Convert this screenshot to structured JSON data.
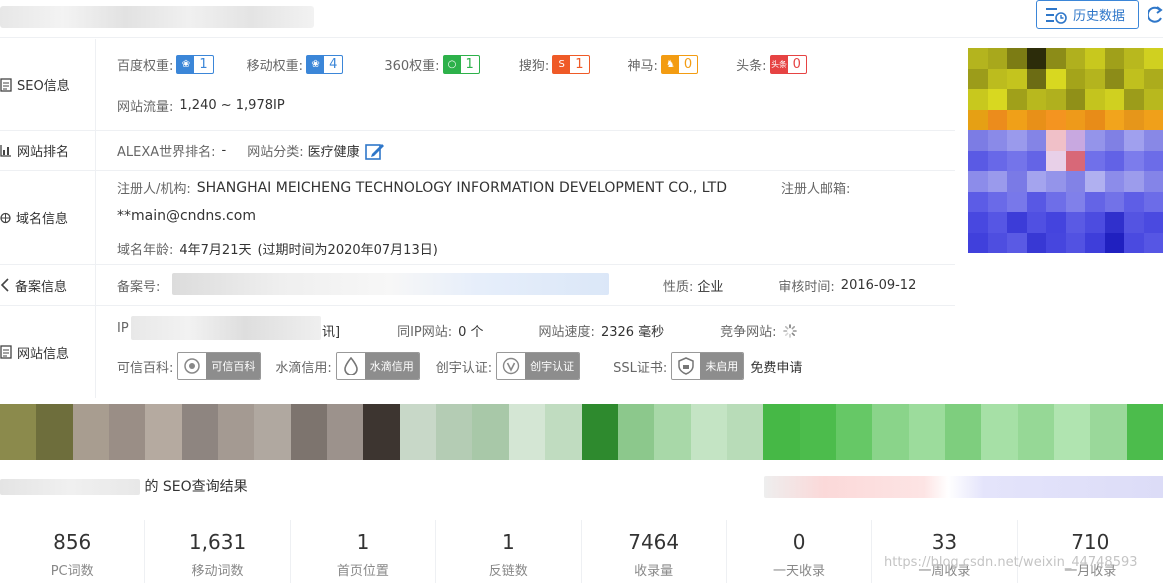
{
  "header": {
    "history_label": "历史数据"
  },
  "seo": {
    "label": "SEO信息",
    "baidu_key": "百度权重:",
    "baidu_val": "1",
    "mobile_key": "移动权重:",
    "mobile_val": "4",
    "q360_key": "360权重:",
    "q360_val": "1",
    "sogou_key": "搜狗:",
    "sogou_val": "1",
    "shenma_key": "神马:",
    "shenma_val": "0",
    "toutiao_key": "头条:",
    "toutiao_val": "0",
    "toutiao_icon_text": "头条",
    "traffic_key": "网站流量:",
    "traffic_val": "1,240 ~ 1,978IP"
  },
  "ranking": {
    "label": "网站排名",
    "alexa_key": "ALEXA世界排名:",
    "alexa_val": "-",
    "category_key": "网站分类:",
    "category_val": "医疗健康"
  },
  "domain": {
    "label": "域名信息",
    "registrant_key": "注册人/机构:",
    "registrant_val": "SHANGHAI MEICHENG TECHNOLOGY INFORMATION DEVELOPMENT CO., LTD",
    "email_key": "注册人邮箱:",
    "email_val": "**main@cndns.com",
    "age_key": "域名年龄:",
    "age_val": "4年7月21天",
    "expire_val": "(过期时间为2020年07月13日)"
  },
  "icp": {
    "label": "备案信息",
    "number_key": "备案号:",
    "nature_key": "性质:",
    "nature_val": "企业",
    "audit_key": "审核时间:",
    "audit_val": "2016-09-12"
  },
  "site": {
    "label": "网站信息",
    "ip_key": "IP",
    "ip_tail": "讯]",
    "same_ip_key": "同IP网站:",
    "same_ip_val": "0 个",
    "speed_key": "网站速度:",
    "speed_val": "2326 毫秒",
    "rival_key": "竞争网站:",
    "kexin_key": "可信百科:",
    "kexin_badge": "可信百科",
    "shuidi_key": "水滴信用:",
    "shuidi_badge": "水滴信用",
    "chuangyu_key": "创宇认证:",
    "chuangyu_badge": "创宇认证",
    "ssl_key": "SSL证书:",
    "ssl_badge": "未启用",
    "ssl_link": "免费申请"
  },
  "query_result": {
    "tail": "的 SEO查询结果"
  },
  "stats": [
    {
      "num": "856",
      "label": "PC词数"
    },
    {
      "num": "1,631",
      "label": "移动词数"
    },
    {
      "num": "1",
      "label": "首页位置"
    },
    {
      "num": "1",
      "label": "反链数"
    },
    {
      "num": "7464",
      "label": "收录量"
    },
    {
      "num": "0",
      "label": "一天收录"
    },
    {
      "num": "33",
      "label": "一周收录"
    },
    {
      "num": "710",
      "label": "一月收录"
    }
  ],
  "watermark": "https://blog.csdn.net/weixin_44748593",
  "colors": {
    "accent": "#3b86d8",
    "border": "#eef0f3",
    "text": "#333333"
  }
}
